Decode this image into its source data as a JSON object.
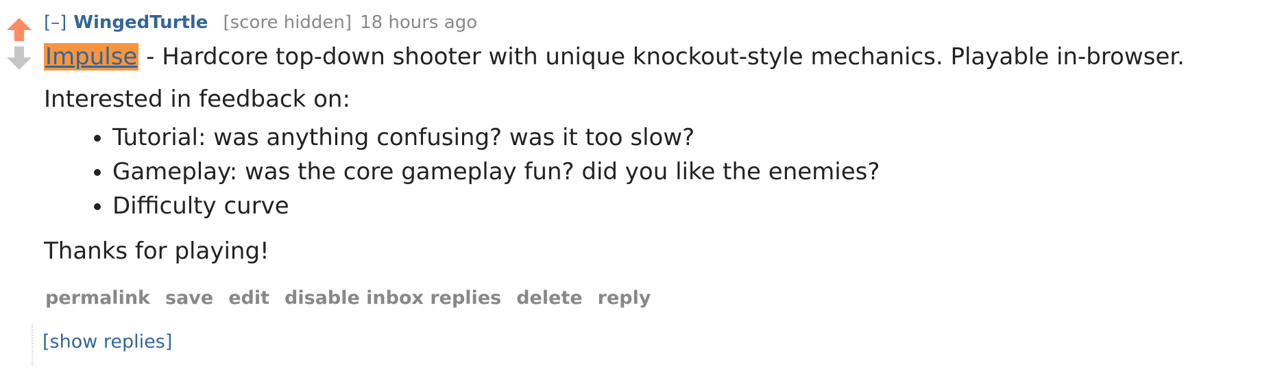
{
  "votes": {
    "upvote_icon": "upvote-arrow-icon",
    "downvote_icon": "downvote-arrow-icon",
    "upvote_color": "#ff8b60",
    "downvote_color": "#c6c6c6"
  },
  "tagline": {
    "expand": "[–]",
    "author": "WingedTurtle",
    "score": "[score hidden]",
    "time": "18 hours ago"
  },
  "body": {
    "link_text": "Impulse",
    "first_line_rest": " - Hardcore top-down shooter with unique knockout-style mechanics. Playable in-browser.",
    "intro": "Interested in feedback on:",
    "bullets": [
      "Tutorial: was anything confusing? was it too slow?",
      "Gameplay: was the core gameplay fun? did you like the enemies?",
      "Difficulty curve"
    ],
    "closing": "Thanks for playing!"
  },
  "buttons": {
    "permalink": "permalink",
    "save": "save",
    "edit": "edit",
    "disable_inbox_replies": "disable inbox replies",
    "delete": "delete",
    "reply": "reply"
  },
  "children": {
    "show_replies": "[show replies]"
  },
  "colors": {
    "link_blue": "#336699",
    "highlight_orange": "#f7953f",
    "muted_gray": "#888888"
  }
}
